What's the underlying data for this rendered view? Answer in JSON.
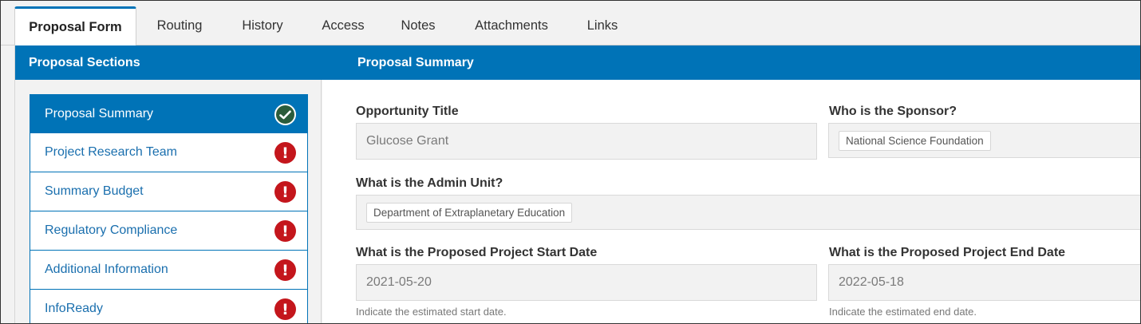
{
  "tabs": [
    {
      "label": "Proposal Form",
      "active": true
    },
    {
      "label": "Routing"
    },
    {
      "label": "History"
    },
    {
      "label": "Access"
    },
    {
      "label": "Notes"
    },
    {
      "label": "Attachments"
    },
    {
      "label": "Links"
    }
  ],
  "sidebar": {
    "title": "Proposal Sections",
    "items": [
      {
        "label": "Proposal Summary",
        "status": "complete",
        "status_icon": "check-circle-icon"
      },
      {
        "label": "Project Research Team",
        "status": "incomplete",
        "status_icon": "exclamation-circle-icon"
      },
      {
        "label": "Summary Budget",
        "status": "incomplete",
        "status_icon": "exclamation-circle-icon"
      },
      {
        "label": "Regulatory Compliance",
        "status": "incomplete",
        "status_icon": "exclamation-circle-icon"
      },
      {
        "label": "Additional Information",
        "status": "incomplete",
        "status_icon": "exclamation-circle-icon"
      },
      {
        "label": "InfoReady",
        "status": "incomplete",
        "status_icon": "exclamation-circle-icon"
      }
    ]
  },
  "main": {
    "title": "Proposal Summary",
    "fields": {
      "opportunity_title": {
        "label": "Opportunity Title",
        "value": "Glucose Grant"
      },
      "sponsor": {
        "label": "Who is the Sponsor?",
        "value": "National Science Foundation"
      },
      "admin_unit": {
        "label": "What is the Admin Unit?",
        "value": "Department of Extraplanetary Education"
      },
      "start_date": {
        "label": "What is the Proposed Project Start Date",
        "value": "2021-05-20",
        "hint": "Indicate the estimated start date."
      },
      "end_date": {
        "label": "What is the Proposed Project End Date",
        "value": "2022-05-18",
        "hint": "Indicate the estimated end date."
      }
    }
  },
  "colors": {
    "primary": "#0073b7",
    "warning": "#c4161c",
    "success": "#2b5c3b"
  }
}
